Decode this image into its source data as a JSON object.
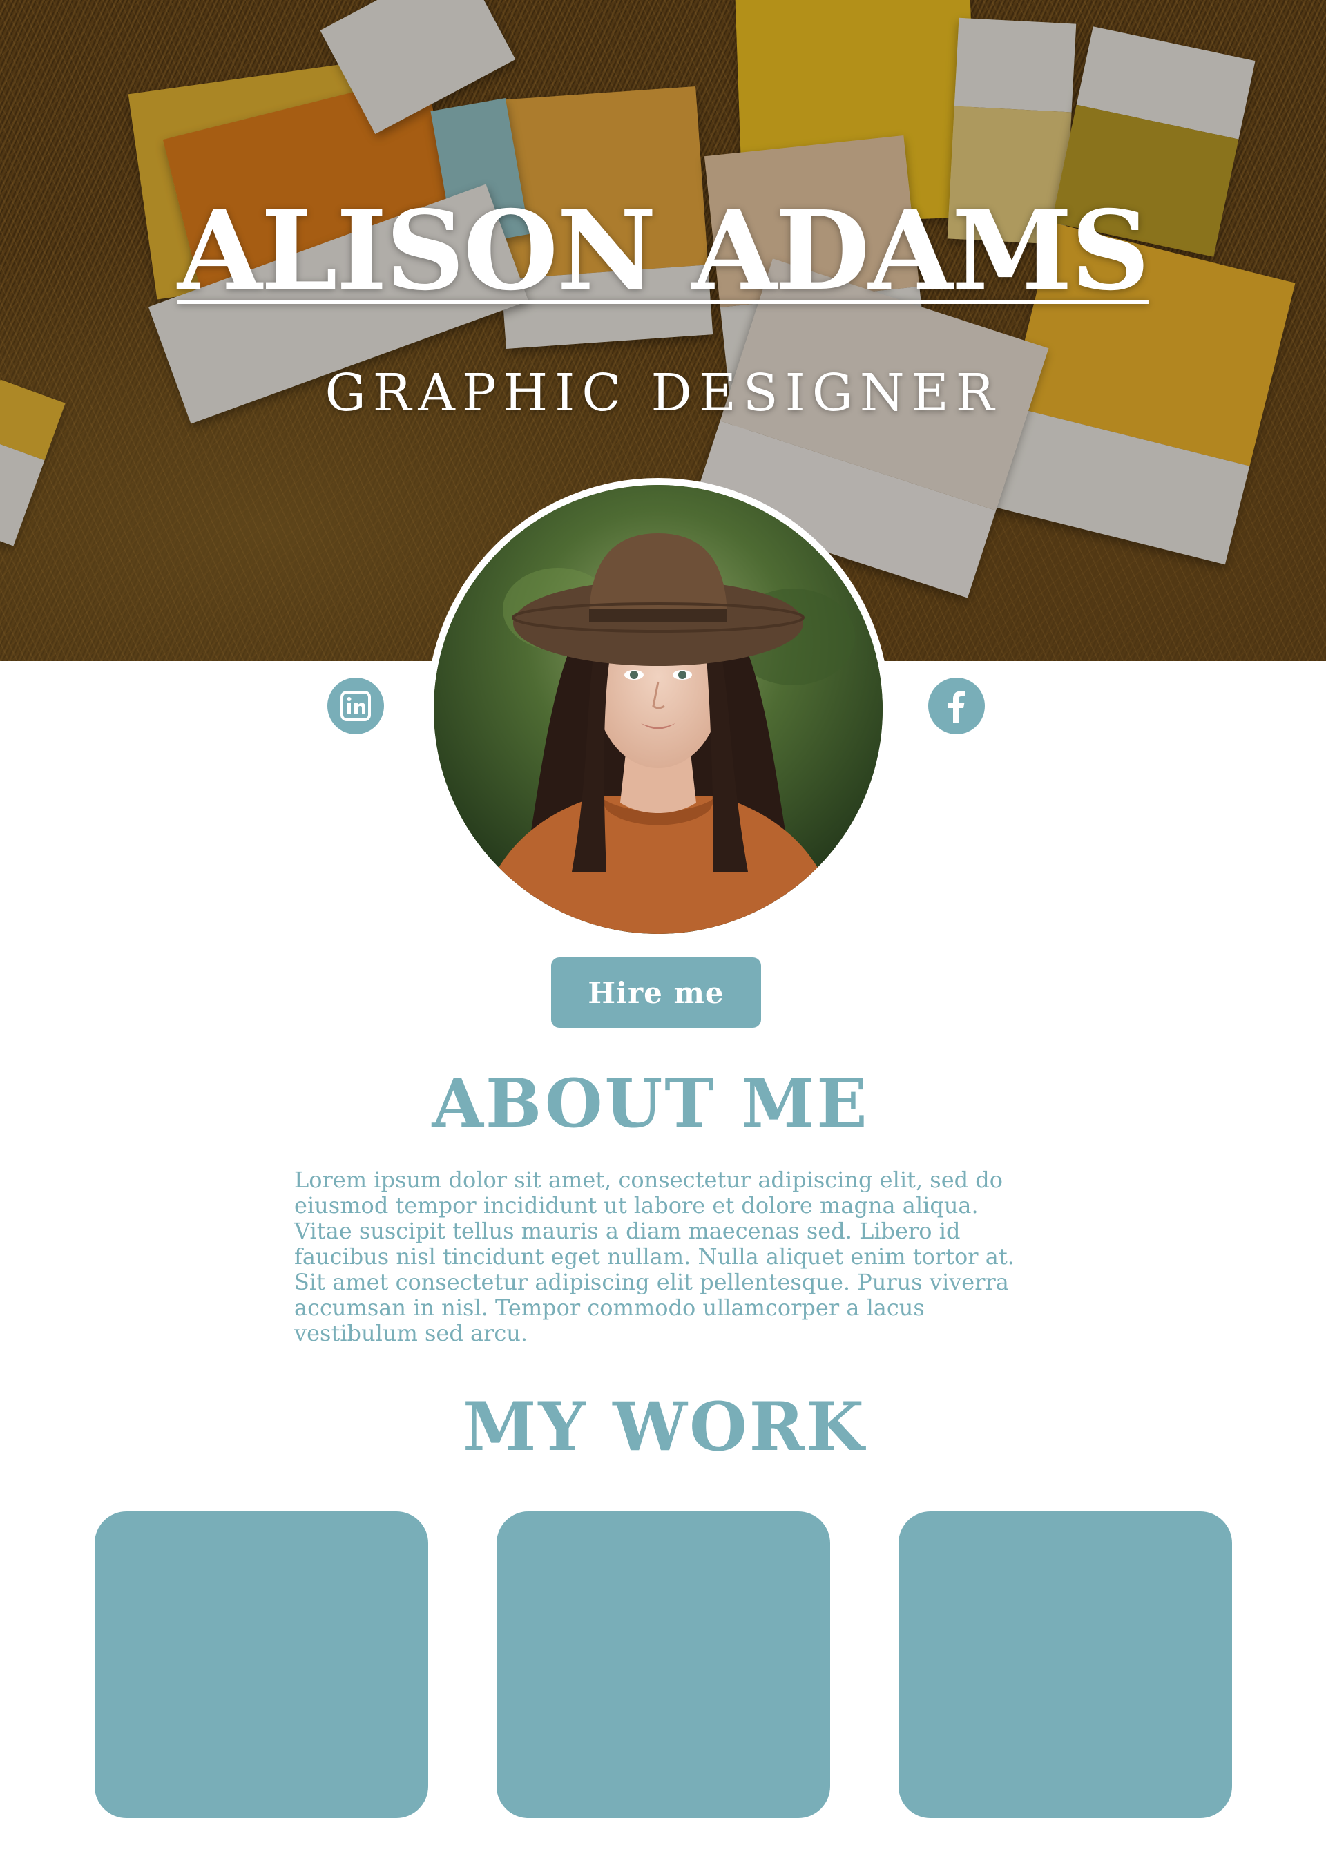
{
  "hero": {
    "name": "ALISON ADAMS",
    "role": "GRAPHIC DESIGNER"
  },
  "profile": {
    "photo_icon": "portrait-photo",
    "social_links": [
      {
        "name": "linkedin",
        "icon": "linkedin-icon",
        "glyph": "in"
      },
      {
        "name": "facebook",
        "icon": "facebook-icon",
        "glyph": "f"
      }
    ]
  },
  "cta": {
    "hire_label": "Hire me"
  },
  "about": {
    "title": "ABOUT ME",
    "lines": [
      "Lorem ipsum dolor sit amet, consectetur adipiscing elit, sed do",
      "eiusmod tempor incididunt ut labore et dolore magna aliqua.",
      "Vitae suscipit tellus mauris a diam maecenas sed. Libero id",
      "faucibus nisl tincidunt eget nullam. Nulla aliquet enim tortor at.",
      "Sit amet consectetur adipiscing elit pellentesque. Purus viverra",
      "accumsan in nisl. Tempor commodo ullamcorper a lacus",
      "vestibulum sed arcu."
    ]
  },
  "work": {
    "title": "MY WORK"
  },
  "colors": {
    "accent": "#79aeb8",
    "background": "#ffffff",
    "hero_text": "#ffffff"
  }
}
